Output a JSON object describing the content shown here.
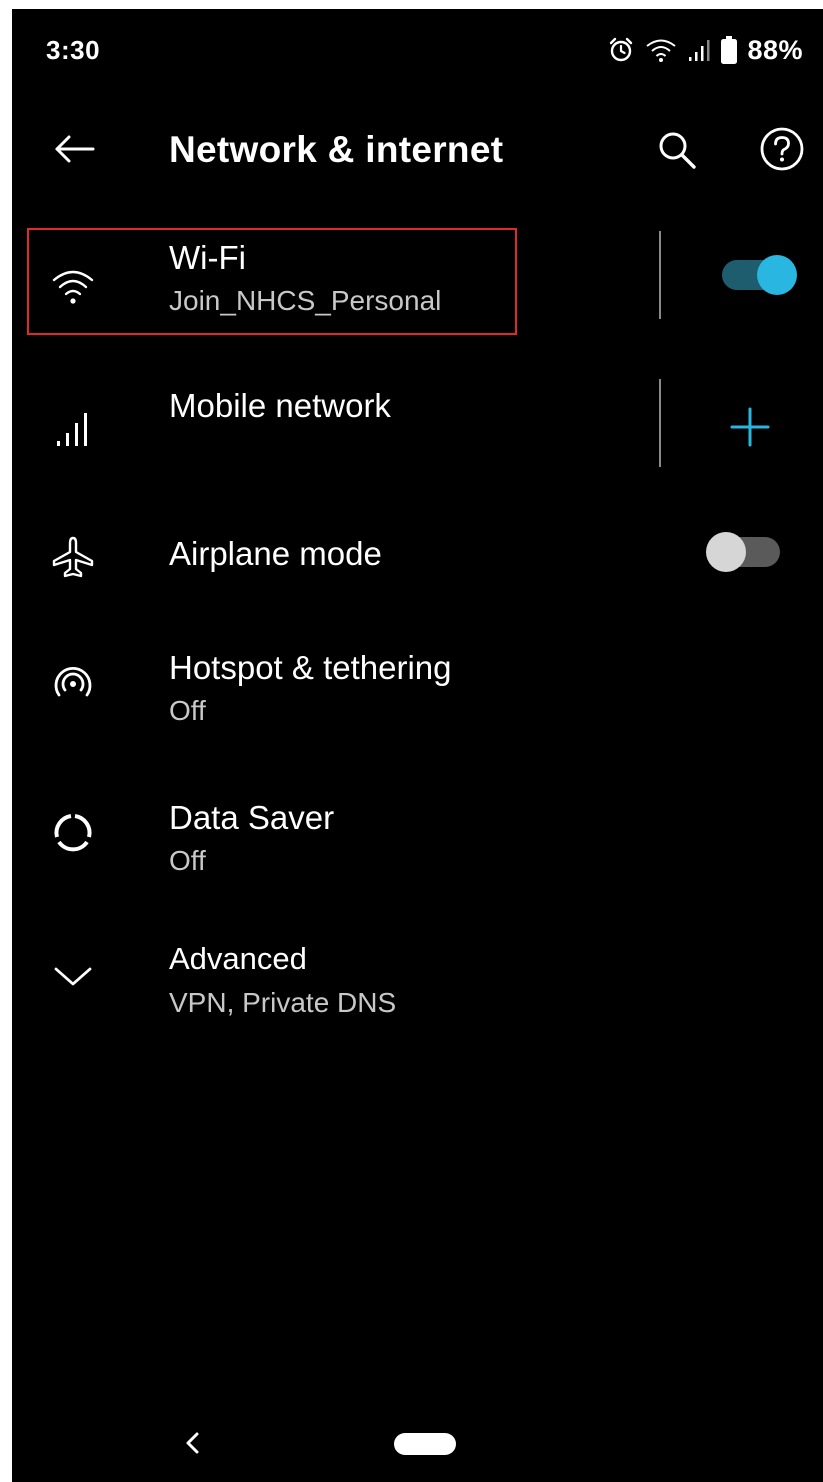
{
  "status_bar": {
    "time": "3:30",
    "battery_percent": "88%",
    "icons": [
      "alarm-icon",
      "wifi-signal-icon",
      "cell-signal-icon",
      "battery-icon"
    ]
  },
  "app_bar": {
    "title": "Network & internet",
    "back_icon": "back-arrow-icon",
    "search_icon": "search-icon",
    "help_icon": "help-icon"
  },
  "settings": {
    "wifi": {
      "title": "Wi-Fi",
      "subtitle": "Join_NHCS_Personal",
      "icon": "wifi-icon",
      "toggle_on": true
    },
    "mobile_network": {
      "title": "Mobile network",
      "icon": "cell-signal-icon",
      "action_icon": "add-icon"
    },
    "airplane_mode": {
      "title": "Airplane mode",
      "icon": "airplane-icon",
      "toggle_on": false
    },
    "hotspot": {
      "title": "Hotspot & tethering",
      "subtitle": "Off",
      "icon": "hotspot-icon"
    },
    "data_saver": {
      "title": "Data Saver",
      "subtitle": "Off",
      "icon": "data-saver-icon"
    },
    "advanced": {
      "title": "Advanced",
      "subtitle": "VPN, Private DNS",
      "icon": "chevron-down-icon"
    }
  },
  "colors": {
    "background": "#000000",
    "text_primary": "#ffffff",
    "text_secondary": "#c8c8c8",
    "accent": "#29b6e0",
    "accent_track": "#1d5d6e",
    "toggle_off_thumb": "#d6d6d6",
    "toggle_off_track": "#5a5a5a",
    "highlight": "#e02a2a"
  },
  "nav_bar": {
    "back_icon": "nav-back-icon",
    "home_icon": "home-pill-icon"
  }
}
